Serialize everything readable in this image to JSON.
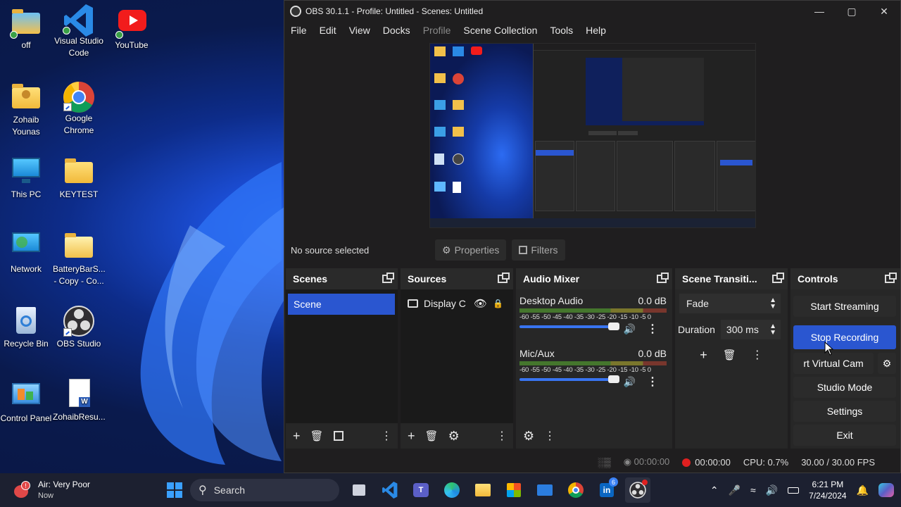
{
  "desktop": {
    "icons": [
      {
        "label": "off"
      },
      {
        "label": "Visual Studio\nCode"
      },
      {
        "label": "YouTube"
      },
      {
        "label": "Zohaib\nYounas"
      },
      {
        "label": "Google\nChrome"
      },
      {
        "label": "This PC"
      },
      {
        "label": "KEYTEST"
      },
      {
        "label": "Network"
      },
      {
        "label": "BatteryBarS...\n- Copy - Co..."
      },
      {
        "label": "Recycle Bin"
      },
      {
        "label": "OBS Studio"
      },
      {
        "label": "Control Panel"
      },
      {
        "label": "ZohaibResu..."
      }
    ]
  },
  "obs": {
    "title": "OBS 30.1.1 - Profile: Untitled - Scenes: Untitled",
    "menu": [
      "File",
      "Edit",
      "View",
      "Docks",
      "Profile",
      "Scene Collection",
      "Tools",
      "Help"
    ],
    "source_toolbar": {
      "no_source": "No source selected",
      "properties": "Properties",
      "filters": "Filters"
    },
    "scenes": {
      "title": "Scenes",
      "items": [
        "Scene"
      ]
    },
    "sources": {
      "title": "Sources",
      "items": [
        "Display C"
      ]
    },
    "mixer": {
      "title": "Audio Mixer",
      "channels": [
        {
          "name": "Desktop Audio",
          "db": "0.0 dB",
          "level": 0.92
        },
        {
          "name": "Mic/Aux",
          "db": "0.0 dB",
          "level": 0.92
        }
      ],
      "ticks": "-60 -55 -50 -45 -40 -35 -30 -25 -20 -15 -10 -5 0"
    },
    "transitions": {
      "title": "Scene Transiti...",
      "type": "Fade",
      "duration_label": "Duration",
      "duration": "300 ms"
    },
    "controls": {
      "title": "Controls",
      "start_streaming": "Start Streaming",
      "stop_recording": "Stop Recording",
      "virtual_cam": "rt Virtual Cam",
      "studio_mode": "Studio Mode",
      "settings": "Settings",
      "exit": "Exit"
    },
    "status": {
      "stream_time": "00:00:00",
      "rec_time": "00:00:00",
      "cpu": "CPU: 0.7%",
      "fps": "30.00 / 30.00 FPS"
    },
    "colors": {
      "accent": "#2a56d0",
      "rec": "#e02020"
    }
  },
  "taskbar": {
    "weather_title": "Air: Very Poor",
    "weather_sub": "Now",
    "search_placeholder": "Search",
    "time": "6:21 PM",
    "date": "7/24/2024",
    "linkedin_badge": "6"
  }
}
